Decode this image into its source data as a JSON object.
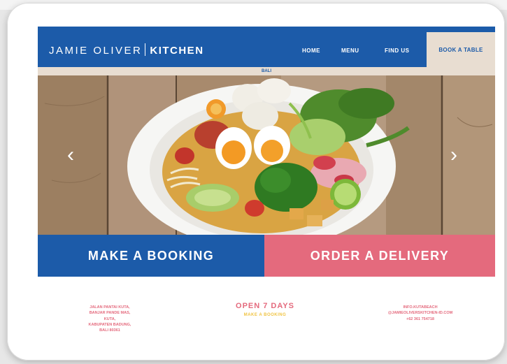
{
  "header": {
    "logo_brand": "JAMIE OLIVER",
    "logo_kitchen": "KITCHEN",
    "nav": {
      "home": "HOME",
      "menu": "MENU",
      "find_us": "FIND US",
      "book_a_table": "BOOK A TABLE"
    },
    "location": "BALI"
  },
  "hero": {
    "prev_arrow": "‹",
    "next_arrow": "›"
  },
  "cta": {
    "booking": "MAKE A BOOKING",
    "delivery": "ORDER A DELIVERY"
  },
  "footer": {
    "address": [
      "JALAN PANTAI KUTA,",
      "BANJAR PANDE MAS,",
      "KUTA,",
      "KABUPATEN BADUNG,",
      "BALI 80361"
    ],
    "hours_title": "OPEN 7 DAYS",
    "hours_link": "MAKE A BOOKING",
    "contact": [
      "INFO.KUTABEACH",
      "@JAMIEOLIVERSKITCHEN-ID.COM",
      "+62 361 754718"
    ]
  },
  "colors": {
    "brand_blue": "#1c5ba9",
    "delivery_pink": "#e46a7d",
    "beige": "#e8ddd1",
    "accent_yellow": "#f0c341"
  }
}
